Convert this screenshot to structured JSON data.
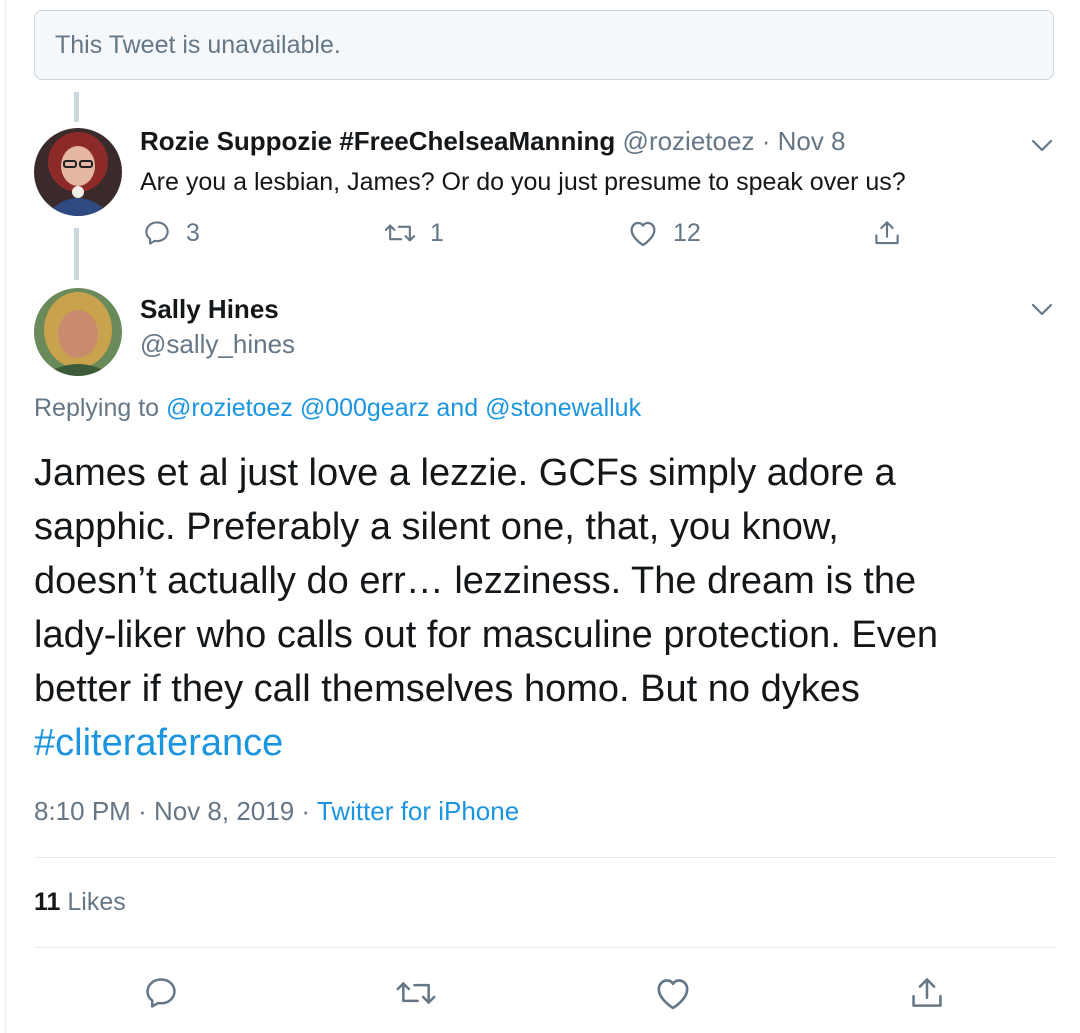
{
  "unavailable_notice": "This Tweet is unavailable.",
  "parent_tweet": {
    "display_name": "Rozie Suppozie #FreeChelseaManning",
    "handle": "@rozietoez",
    "separator": "·",
    "date": "Nov 8",
    "text": "Are you a lesbian, James? Or do you just presume to speak over us?",
    "reply_count": "3",
    "retweet_count": "1",
    "like_count": "12"
  },
  "main_tweet": {
    "display_name": "Sally Hines",
    "handle": "@sally_hines",
    "replying_to_prefix": "Replying to",
    "replying_to_1": "@rozietoez",
    "replying_to_2": "@000gearz",
    "replying_to_and": "and",
    "replying_to_3": "@stonewalluk",
    "body_lines": [
      "James et al just love a lezzie. GCFs simply adore a",
      "sapphic. Preferably a silent one, that, you know,",
      "doesn’t actually do err… lezziness. The dream is the",
      "lady-liker who calls out for masculine protection. Even",
      "better if they call themselves homo. But no dykes"
    ],
    "hashtag": "#cliteraferance",
    "time": "8:10 PM",
    "date": "Nov 8, 2019",
    "separator": "·",
    "source": "Twitter for iPhone",
    "likes_count": "11",
    "likes_label": "Likes"
  },
  "icons": {
    "reply": "reply-icon",
    "retweet": "retweet-icon",
    "like": "heart-icon",
    "share": "share-icon",
    "menu": "chevron-down-icon"
  },
  "colors": {
    "accent": "#1b95e0",
    "muted": "#657786",
    "text": "#14171a",
    "border": "#e6ecf0"
  }
}
